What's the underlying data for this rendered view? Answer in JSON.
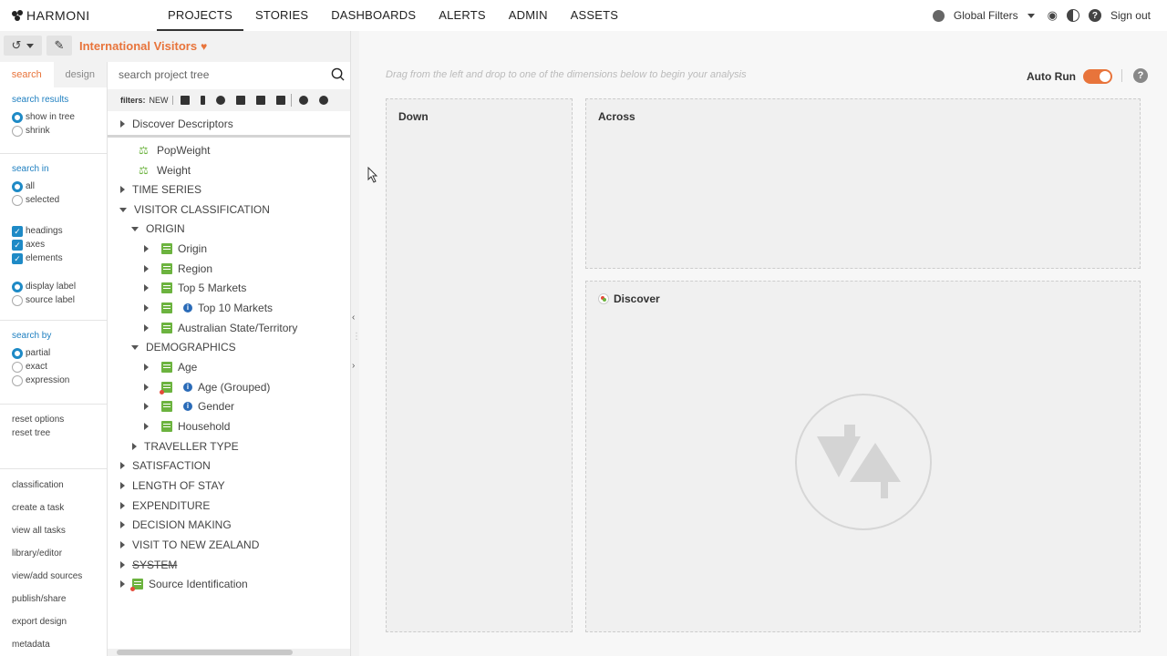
{
  "brand": {
    "name": "HARMONI"
  },
  "nav": {
    "items": [
      {
        "label": "PROJECTS",
        "active": true
      },
      {
        "label": "STORIES",
        "active": false
      },
      {
        "label": "DASHBOARDS",
        "active": false
      },
      {
        "label": "ALERTS",
        "active": false
      },
      {
        "label": "ADMIN",
        "active": false
      },
      {
        "label": "ASSETS",
        "active": false
      }
    ],
    "global_filters": "Global Filters",
    "sign_out": "Sign out"
  },
  "project": {
    "title": "International Visitors"
  },
  "options": {
    "tabs": [
      {
        "label": "search",
        "active": true
      },
      {
        "label": "design",
        "active": false
      }
    ],
    "search_results": {
      "title": "search results",
      "options": [
        "show in tree",
        "shrink"
      ],
      "selected": "show in tree"
    },
    "search_in": {
      "title": "search in",
      "options": [
        "all",
        "selected"
      ],
      "selected": "all"
    },
    "checks": [
      "headings",
      "axes",
      "elements"
    ],
    "label_type": {
      "options": [
        "display label",
        "source label"
      ],
      "selected": "display label"
    },
    "search_by": {
      "title": "search by",
      "options": [
        "partial",
        "exact",
        "expression"
      ],
      "selected": "partial"
    },
    "reset": [
      "reset options",
      "reset tree"
    ],
    "links": [
      "classification",
      "create a task",
      "view all tasks",
      "library/editor",
      "view/add sources",
      "publish/share",
      "export design",
      "metadata"
    ]
  },
  "tree": {
    "search_placeholder": "search project tree",
    "filters_label": "filters:",
    "filters_new": "NEW",
    "items": [
      {
        "label": "Discover Descriptors",
        "level": 0,
        "arrow": "right",
        "icon": ""
      },
      {
        "label": "PopWeight",
        "level": 1,
        "arrow": "",
        "icon": "scale"
      },
      {
        "label": "Weight",
        "level": 1,
        "arrow": "",
        "icon": "scale"
      },
      {
        "label": "TIME SERIES",
        "level": 0,
        "arrow": "right",
        "icon": ""
      },
      {
        "label": "VISITOR CLASSIFICATION",
        "level": 0,
        "arrow": "down",
        "icon": ""
      },
      {
        "label": "ORIGIN",
        "level": 1,
        "arrow": "down",
        "icon": ""
      },
      {
        "label": "Origin",
        "level": 2,
        "arrow": "right",
        "icon": "green"
      },
      {
        "label": "Region",
        "level": 2,
        "arrow": "right",
        "icon": "green"
      },
      {
        "label": "Top 5 Markets",
        "level": 2,
        "arrow": "right",
        "icon": "green"
      },
      {
        "label": "Top 10 Markets",
        "level": 2,
        "arrow": "right",
        "icon": "green-info"
      },
      {
        "label": "Australian State/Territory",
        "level": 2,
        "arrow": "right",
        "icon": "green"
      },
      {
        "label": "DEMOGRAPHICS",
        "level": 1,
        "arrow": "down",
        "icon": ""
      },
      {
        "label": "Age",
        "level": 2,
        "arrow": "right",
        "icon": "green"
      },
      {
        "label": "Age (Grouped)",
        "level": 2,
        "arrow": "right",
        "icon": "red-info"
      },
      {
        "label": "Gender",
        "level": 2,
        "arrow": "right",
        "icon": "green-info"
      },
      {
        "label": "Household",
        "level": 2,
        "arrow": "right",
        "icon": "green"
      },
      {
        "label": "TRAVELLER TYPE",
        "level": 1,
        "arrow": "right",
        "icon": ""
      },
      {
        "label": "SATISFACTION",
        "level": 0,
        "arrow": "right",
        "icon": ""
      },
      {
        "label": "LENGTH OF STAY",
        "level": 0,
        "arrow": "right",
        "icon": ""
      },
      {
        "label": "EXPENDITURE",
        "level": 0,
        "arrow": "right",
        "icon": ""
      },
      {
        "label": "DECISION MAKING",
        "level": 0,
        "arrow": "right",
        "icon": ""
      },
      {
        "label": "VISIT TO NEW ZEALAND",
        "level": 0,
        "arrow": "right",
        "icon": ""
      },
      {
        "label": "SYSTEM",
        "level": 0,
        "arrow": "right",
        "icon": "strike"
      },
      {
        "label": "Source Identification",
        "level": 0,
        "arrow": "right",
        "icon": "red"
      }
    ]
  },
  "main": {
    "hint": "Drag from the left and drop to one of the dimensions below to begin your analysis",
    "auto_run": "Auto Run",
    "zones": {
      "down": "Down",
      "across": "Across",
      "discover": "Discover"
    }
  },
  "colors": {
    "accent": "#e8743b",
    "link": "#1e7fc0",
    "tree_icon": "#6cb33f"
  }
}
